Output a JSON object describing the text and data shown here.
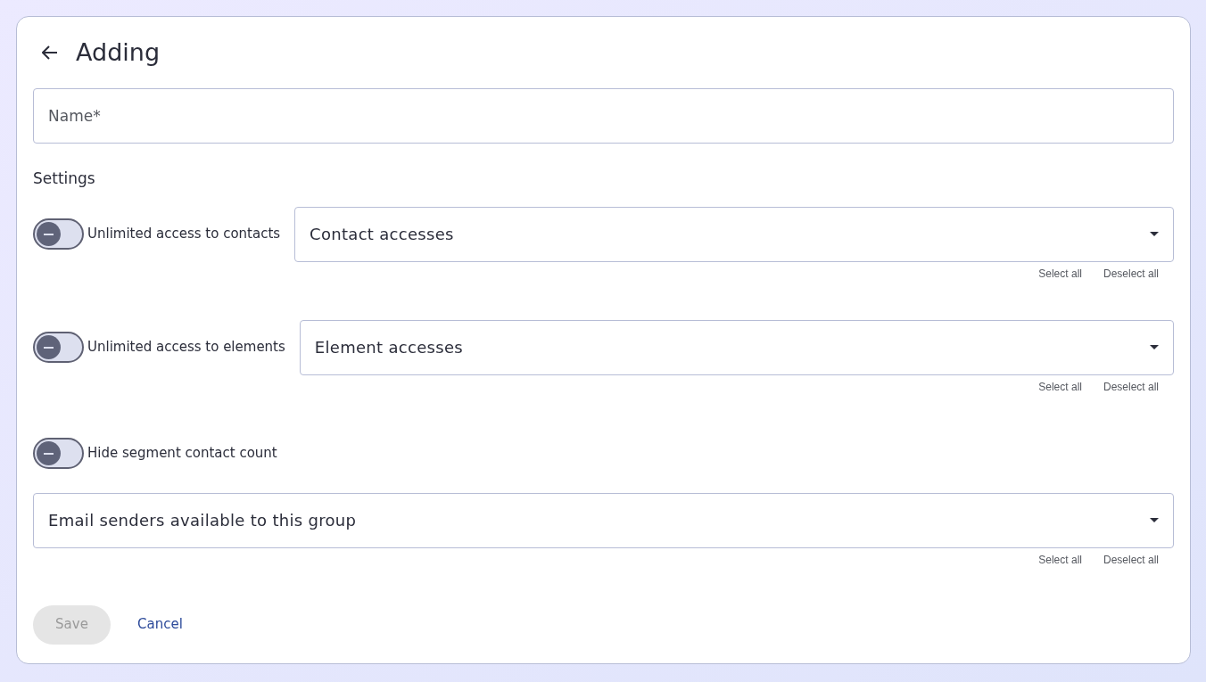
{
  "header": {
    "title": "Adding"
  },
  "name_field": {
    "placeholder": "Name*"
  },
  "settings_title": "Settings",
  "rows": [
    {
      "kind": "toggle_select",
      "toggle": {
        "label": "Unlimited access to contacts",
        "on": false
      },
      "select": {
        "placeholder": "Contact accesses",
        "actions": [
          "Select all",
          "Deselect all"
        ]
      }
    },
    {
      "kind": "toggle_select",
      "toggle": {
        "label": "Unlimited access to elements",
        "on": false
      },
      "select": {
        "placeholder": "Element accesses",
        "actions": [
          "Select all",
          "Deselect all"
        ]
      }
    },
    {
      "kind": "toggle",
      "toggle": {
        "label": "Hide segment contact count",
        "on": false
      }
    },
    {
      "kind": "select",
      "select": {
        "placeholder": "Email senders available to this group",
        "actions": [
          "Select all",
          "Deselect all"
        ]
      }
    }
  ],
  "buttons": {
    "save": {
      "label": "Save",
      "disabled": true
    },
    "cancel": {
      "label": "Cancel"
    }
  }
}
